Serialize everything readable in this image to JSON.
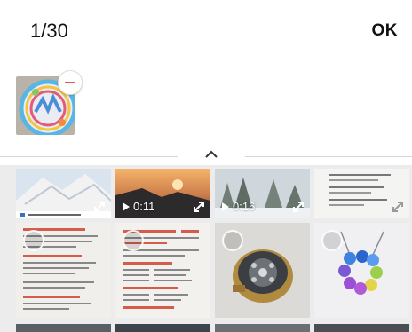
{
  "header": {
    "selection_count": "1/30",
    "ok_label": "OK"
  },
  "selected": {
    "items": [
      {
        "kind": "photo",
        "remove_icon": "minus-circle-icon"
      }
    ]
  },
  "collapse_icon": "chevron-up-icon",
  "grid": {
    "rows": [
      [
        {
          "kind": "photo",
          "duration": ""
        },
        {
          "kind": "video",
          "duration": "0:11"
        },
        {
          "kind": "video",
          "duration": "0:16"
        },
        {
          "kind": "photo",
          "duration": ""
        }
      ],
      [
        {
          "kind": "photo",
          "duration": ""
        },
        {
          "kind": "photo",
          "duration": ""
        },
        {
          "kind": "photo",
          "duration": ""
        },
        {
          "kind": "photo",
          "duration": ""
        }
      ],
      [
        {
          "kind": "photo",
          "duration": ""
        },
        {
          "kind": "photo",
          "duration": ""
        },
        {
          "kind": "photo",
          "duration": ""
        },
        {
          "kind": "photo",
          "duration": ""
        }
      ]
    ]
  },
  "colors": {
    "remove_badge": "#e25a54",
    "grid_background": "#ececec"
  }
}
